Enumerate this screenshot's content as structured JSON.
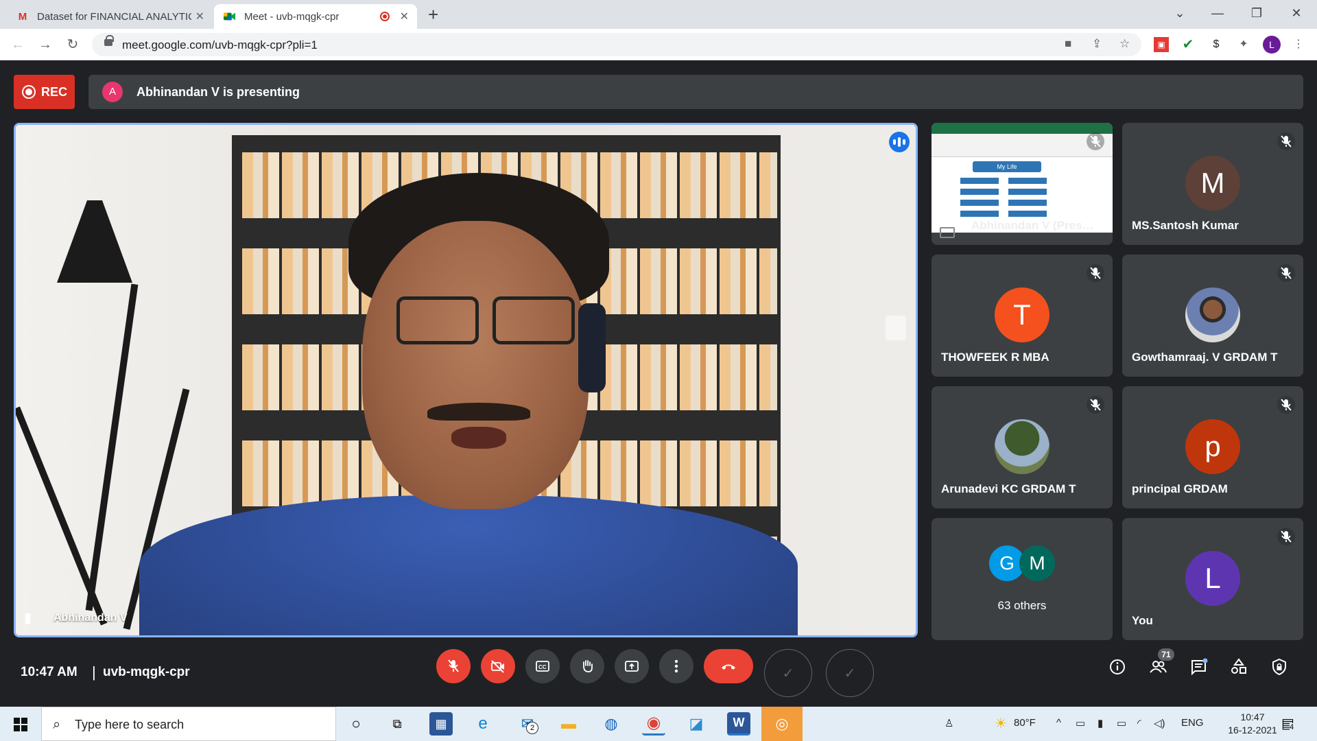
{
  "browser": {
    "tabs": [
      {
        "title": "Dataset for FINANCIAL ANALYTIC",
        "icon": "gmail-icon",
        "active": false
      },
      {
        "title": "Meet - uvb-mqgk-cpr",
        "icon": "meet-icon",
        "active": true
      }
    ],
    "url": "meet.google.com/uvb-mqgk-cpr?pli=1",
    "profile_initial": "L"
  },
  "meet": {
    "rec_label": "REC",
    "presenter_initial": "A",
    "presenting_text": "Abhinandan V is presenting",
    "main_speaker": "Abhinandan V",
    "tiles": [
      {
        "name": "Abhinandan V (Pres…",
        "kind": "screen",
        "screen_title": "My Life"
      },
      {
        "name": "MS.Santosh Kumar",
        "initial": "M",
        "color": "#5d4037"
      },
      {
        "name": "THOWFEEK R MBA",
        "initial": "T",
        "color": "#f4511e"
      },
      {
        "name": "Gowthamraaj. V GRDAM T",
        "initial": "",
        "color": "#c7c7c7"
      },
      {
        "name": "Arunadevi KC GRDAM T",
        "initial": "",
        "color": "#7f8f6a"
      },
      {
        "name": "principal GRDAM",
        "initial": "p",
        "color": "#c0360c"
      },
      {
        "name": "63 others",
        "group": [
          "G",
          "M"
        ],
        "group_colors": [
          "#039be5",
          "#00695c"
        ]
      },
      {
        "name": "You",
        "initial": "L",
        "color": "#5e35b1"
      }
    ],
    "time": "10:47 AM",
    "separator": "|",
    "meeting_code": "uvb-mqgk-cpr",
    "participant_count": "71"
  },
  "taskbar": {
    "search_placeholder": "Type here to search",
    "weather": "80°F",
    "language": "ENG",
    "time": "10:47",
    "date": "16-12-2021",
    "mail_badge": "2",
    "notification_count": "4"
  }
}
